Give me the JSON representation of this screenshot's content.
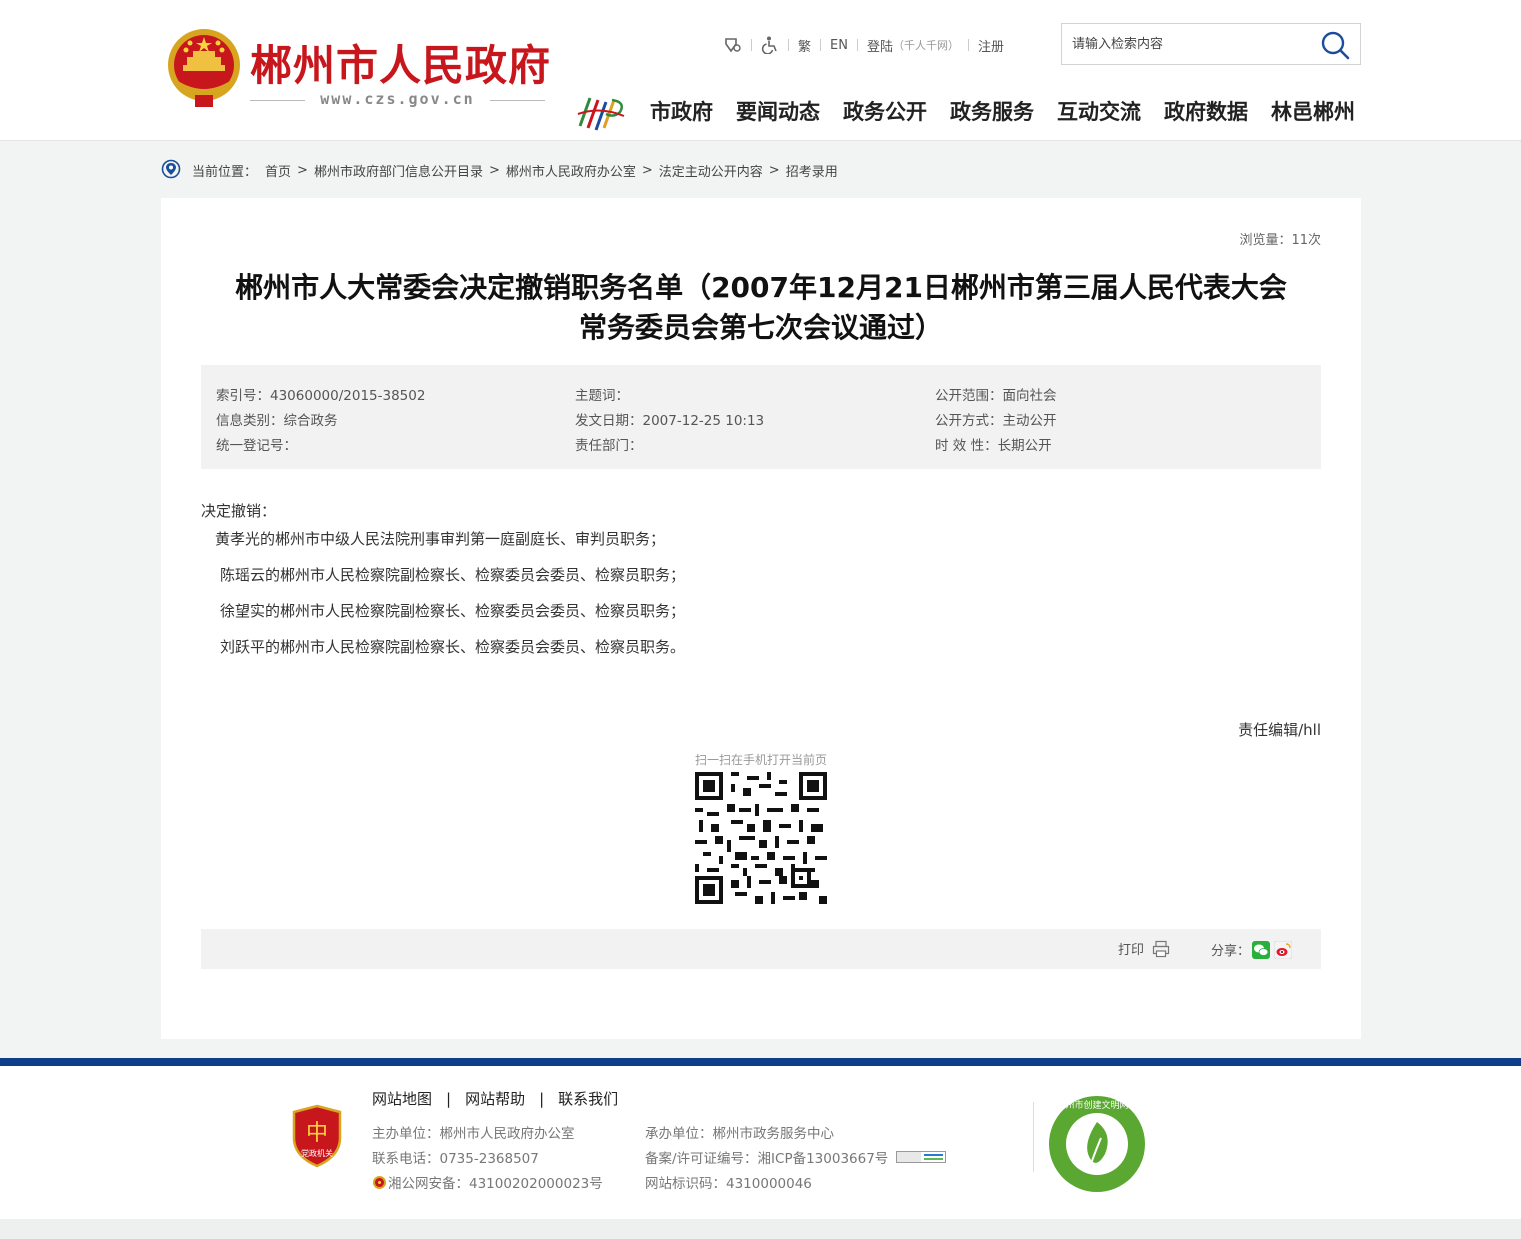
{
  "header": {
    "site_title": "郴州市人民政府",
    "site_domain": "www.czs.gov.cn",
    "topbar": {
      "traditional": "繁",
      "english": "EN",
      "login": "登陆",
      "login_note": "（千人千网）",
      "register": "注册"
    },
    "search": {
      "placeholder": "请输入检索内容"
    },
    "nav": [
      "市政府",
      "要闻动态",
      "政务公开",
      "政务服务",
      "互动交流",
      "政府数据",
      "林邑郴州"
    ]
  },
  "breadcrumb": {
    "label": "当前位置：",
    "items": [
      "首页",
      "郴州市政府部门信息公开目录",
      "郴州市人民政府办公室",
      "法定主动公开内容",
      "招考录用"
    ],
    "separator": ">"
  },
  "article": {
    "views": "浏览量：11次",
    "title_line1": "郴州市人大常委会决定撤销职务名单（2007年12月21日郴州市第三届人民代表大会",
    "title_line2": "常务委员会第七次会议通过）",
    "meta": {
      "index_no": "索引号：43060000/2015-38502",
      "info_type": "信息类别：综合政务",
      "reg_no": "统一登记号：",
      "keywords": "主题词：",
      "issue_date": "发文日期：2007-12-25 10:13",
      "department": "责任部门：",
      "scope": "公开范围：面向社会",
      "method": "公开方式：主动公开",
      "validity": "时 效 性：长期公开"
    },
    "body": [
      "决定撤销：",
      "黄孝光的郴州市中级人民法院刑事审判第一庭副庭长、审判员职务；",
      "陈瑶云的郴州市人民检察院副检察长、检察委员会委员、检察员职务；",
      "徐望实的郴州市人民检察院副检察长、检察委员会委员、检察员职务；",
      "刘跃平的郴州市人民检察院副检察长、检察委员会委员、检察员职务。"
    ],
    "editor": "责任编辑/hll",
    "qr_caption": "扫一扫在手机打开当前页",
    "print_label": "打印",
    "share_label": "分享："
  },
  "footer": {
    "links": [
      "网站地图",
      "网站帮助",
      "联系我们"
    ],
    "link_sep": "|",
    "sponsor": "主办单位：郴州市人民政府办公室",
    "phone": "联系电话：0735-2368507",
    "police": "湘公网安备：43100202000023号",
    "undertaker": "承办单位：郴州市政务服务中心",
    "icp": "备案/许可证编号：湘ICP备13003667号",
    "site_id": "网站标识码：4310000046",
    "badge_text": "党政机关",
    "civ_text": "郴州市创建文明网站"
  },
  "colors": {
    "brand_red": "#c8161d",
    "footer_blue": "#0e3e8a",
    "nav_blue": "#1a4d9c"
  }
}
